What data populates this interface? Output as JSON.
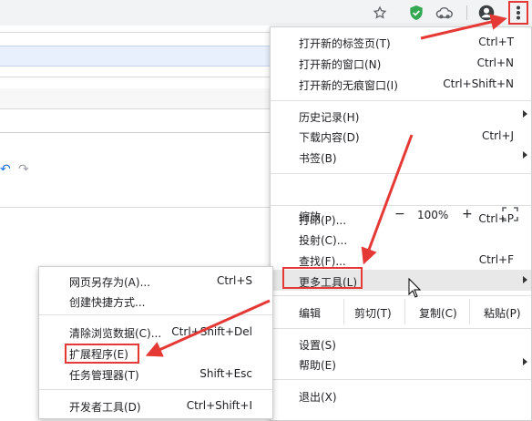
{
  "colors": {
    "annotation_red": "#e53935",
    "toolbar_bg": "#f1f3f4",
    "shield_green": "#34a853"
  },
  "toolbar": {
    "icons": [
      "star-icon",
      "shield-check-icon",
      "extension-cloud-icon",
      "account-icon",
      "more-vert-icon"
    ]
  },
  "main_menu": {
    "new_tab": {
      "label": "打开新的标签页(T)",
      "shortcut": "Ctrl+T"
    },
    "new_window": {
      "label": "打开新的窗口(N)",
      "shortcut": "Ctrl+N"
    },
    "incognito": {
      "label": "打开新的无痕窗口(I)",
      "shortcut": "Ctrl+Shift+N"
    },
    "history": {
      "label": "历史记录(H)"
    },
    "downloads": {
      "label": "下载内容(D)",
      "shortcut": "Ctrl+J"
    },
    "bookmarks": {
      "label": "书签(B)"
    },
    "zoom": {
      "label": "缩放",
      "minus": "−",
      "value": "100%",
      "plus": "+"
    },
    "print": {
      "label": "打印(P)...",
      "shortcut": "Ctrl+P"
    },
    "cast": {
      "label": "投射(C)..."
    },
    "find": {
      "label": "查找(F)...",
      "shortcut": "Ctrl+F"
    },
    "more_tools": {
      "label": "更多工具(L)"
    },
    "edit": {
      "label": "编辑",
      "cut": "剪切(T)",
      "copy": "复制(C)",
      "paste": "粘贴(P)"
    },
    "settings": {
      "label": "设置(S)"
    },
    "help": {
      "label": "帮助(E)"
    },
    "exit": {
      "label": "退出(X)"
    }
  },
  "sub_menu": {
    "save_page": {
      "label": "网页另存为(A)...",
      "shortcut": "Ctrl+S"
    },
    "create_shortcut": {
      "label": "创建快捷方式..."
    },
    "clear_data": {
      "label": "清除浏览数据(C)...",
      "shortcut": "Ctrl+Shift+Del"
    },
    "extensions": {
      "label": "扩展程序(E)"
    },
    "task_manager": {
      "label": "任务管理器(T)",
      "shortcut": "Shift+Esc"
    },
    "dev_tools": {
      "label": "开发者工具(D)",
      "shortcut": "Ctrl+Shift+I"
    }
  }
}
